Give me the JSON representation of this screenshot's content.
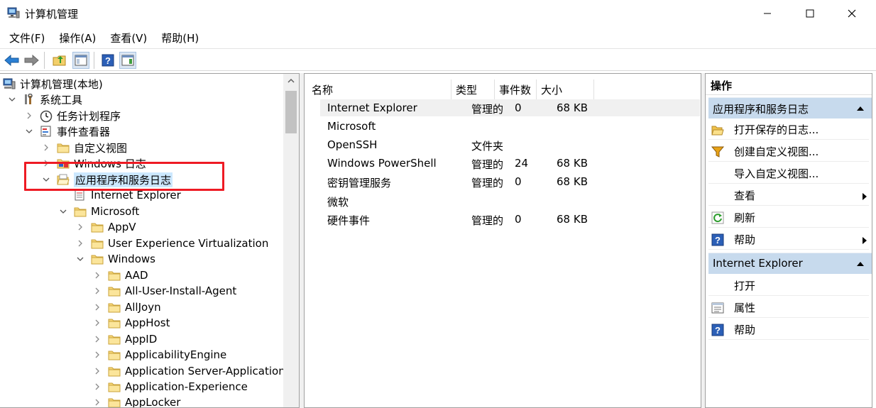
{
  "window": {
    "title": "计算机管理"
  },
  "menu": [
    "文件(F)",
    "操作(A)",
    "查看(V)",
    "帮助(H)"
  ],
  "tree": [
    {
      "label": "计算机管理(本地)",
      "icon": "computer-management-icon",
      "expander": "none"
    },
    {
      "label": "系统工具",
      "icon": "tools-icon",
      "expander": "open"
    },
    {
      "label": "任务计划程序",
      "icon": "clock-icon",
      "expander": "closed"
    },
    {
      "label": "事件查看器",
      "icon": "event-viewer-icon",
      "expander": "open"
    },
    {
      "label": "自定义视图",
      "icon": "folder-icon",
      "expander": "closed"
    },
    {
      "label": "Windows 日志",
      "icon": "windows-log-icon",
      "expander": "closed"
    },
    {
      "label": "应用程序和服务日志",
      "icon": "folder-open-icon",
      "expander": "open",
      "selected": true
    },
    {
      "label": "Internet Explorer",
      "icon": "log-icon",
      "expander": "none"
    },
    {
      "label": "Microsoft",
      "icon": "folder-icon",
      "expander": "open"
    },
    {
      "label": "AppV",
      "icon": "folder-icon",
      "expander": "closed"
    },
    {
      "label": "User Experience Virtualization",
      "icon": "folder-icon",
      "expander": "closed"
    },
    {
      "label": "Windows",
      "icon": "folder-icon",
      "expander": "open"
    },
    {
      "label": "AAD",
      "icon": "folder-icon",
      "expander": "closed"
    },
    {
      "label": "All-User-Install-Agent",
      "icon": "folder-icon",
      "expander": "closed"
    },
    {
      "label": "AllJoyn",
      "icon": "folder-icon",
      "expander": "closed"
    },
    {
      "label": "AppHost",
      "icon": "folder-icon",
      "expander": "closed"
    },
    {
      "label": "AppID",
      "icon": "folder-icon",
      "expander": "closed"
    },
    {
      "label": "ApplicabilityEngine",
      "icon": "folder-icon",
      "expander": "closed"
    },
    {
      "label": "Application Server-Applications",
      "icon": "folder-icon",
      "expander": "closed"
    },
    {
      "label": "Application-Experience",
      "icon": "folder-icon",
      "expander": "closed"
    },
    {
      "label": "AppLocker",
      "icon": "folder-icon",
      "expander": "closed"
    }
  ],
  "list": {
    "columns": [
      "名称",
      "类型",
      "事件数",
      "大小"
    ],
    "rows": [
      {
        "name": "Internet Explorer",
        "type": "管理的",
        "count": "0",
        "size": "68 KB"
      },
      {
        "name": "Microsoft",
        "type": "",
        "count": "",
        "size": ""
      },
      {
        "name": "OpenSSH",
        "type": "文件夹",
        "count": "",
        "size": ""
      },
      {
        "name": "Windows PowerShell",
        "type": "管理的",
        "count": "24",
        "size": "68 KB"
      },
      {
        "name": "密钥管理服务",
        "type": "管理的",
        "count": "0",
        "size": "68 KB"
      },
      {
        "name": "微软",
        "type": "",
        "count": "",
        "size": ""
      },
      {
        "name": "硬件事件",
        "type": "管理的",
        "count": "0",
        "size": "68 KB"
      }
    ]
  },
  "actions": {
    "title": "操作",
    "section1": {
      "label": "应用程序和服务日志",
      "items": [
        {
          "label": "打开保存的日志...",
          "icon": "open-folder-icon"
        },
        {
          "label": "创建自定义视图...",
          "icon": "filter-icon"
        },
        {
          "label": "导入自定义视图...",
          "icon": ""
        },
        {
          "label": "查看",
          "icon": "",
          "submenu": true
        },
        {
          "label": "刷新",
          "icon": "refresh-icon"
        },
        {
          "label": "帮助",
          "icon": "help-icon",
          "submenu": true
        }
      ]
    },
    "section2": {
      "label": "Internet Explorer",
      "items": [
        {
          "label": "打开",
          "icon": ""
        },
        {
          "label": "属性",
          "icon": "properties-icon"
        },
        {
          "label": "帮助",
          "icon": "help-icon"
        }
      ]
    }
  }
}
